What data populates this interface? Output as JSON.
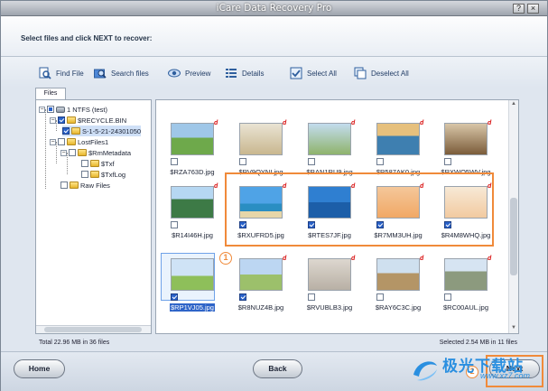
{
  "window": {
    "title": "iCare Data Recovery Pro",
    "controls": [
      "?",
      "×"
    ]
  },
  "header": {
    "instruction": "Select files and click NEXT to recover:"
  },
  "toolbar": {
    "find_file": "Find File",
    "search_files": "Search files",
    "preview": "Preview",
    "details": "Details",
    "select_all": "Select All",
    "deselect_all": "Deselect All"
  },
  "files_tab": "Files",
  "tree": {
    "root": "1 NTFS (test)",
    "recycle": "$RECYCLE.BIN",
    "sid": "S-1-5-21-24301050",
    "lostfiles": "LostFiles1",
    "rmmetadata": "$RmMetadata",
    "txf": "$Txf",
    "txflog": "$TxfLog",
    "rawfiles": "Raw Files"
  },
  "files": [
    {
      "name": "$RZA763D.jpg",
      "checked": false,
      "deleted": true
    },
    {
      "name": "$RV9QYNI.jpg",
      "checked": false,
      "deleted": true
    },
    {
      "name": "$RAN1RU9.jpg",
      "checked": false,
      "deleted": true
    },
    {
      "name": "$R587AK0.jpg",
      "checked": false,
      "deleted": true
    },
    {
      "name": "$RXWO5WV.jpg",
      "checked": false,
      "deleted": true
    },
    {
      "name": "$R14I46H.jpg",
      "checked": false,
      "deleted": true
    },
    {
      "name": "$RXUFRD5.jpg",
      "checked": true,
      "deleted": true
    },
    {
      "name": "$RTES7JF.jpg",
      "checked": true,
      "deleted": true
    },
    {
      "name": "$R7MM3UH.jpg",
      "checked": true,
      "deleted": true
    },
    {
      "name": "$R4M8WHQ.jpg",
      "checked": true,
      "deleted": true
    },
    {
      "name": "$RP1VJ05.jpg",
      "checked": true,
      "deleted": false
    },
    {
      "name": "$R8NUZ4B.jpg",
      "checked": true,
      "deleted": true
    },
    {
      "name": "$RVUBLB3.jpg",
      "checked": false,
      "deleted": true
    },
    {
      "name": "$RAY6C3C.jpg",
      "checked": false,
      "deleted": true
    },
    {
      "name": "$RC00AUL.jpg",
      "checked": false,
      "deleted": true
    }
  ],
  "deleted_marker": "d",
  "badges": [
    "1",
    "2"
  ],
  "status": {
    "total": "Total 22.96 MB in 36 files",
    "selected": "Selected 2.54 MB in 11 files"
  },
  "footer": {
    "home": "Home",
    "back": "Back",
    "next": "Next"
  },
  "watermark": {
    "brand": "极光下载站",
    "url": "www.xz7.com"
  },
  "colors": {
    "accent_orange": "#f08a3a",
    "selection_blue": "#2e64c8",
    "deleted_red": "#d80c0c"
  }
}
